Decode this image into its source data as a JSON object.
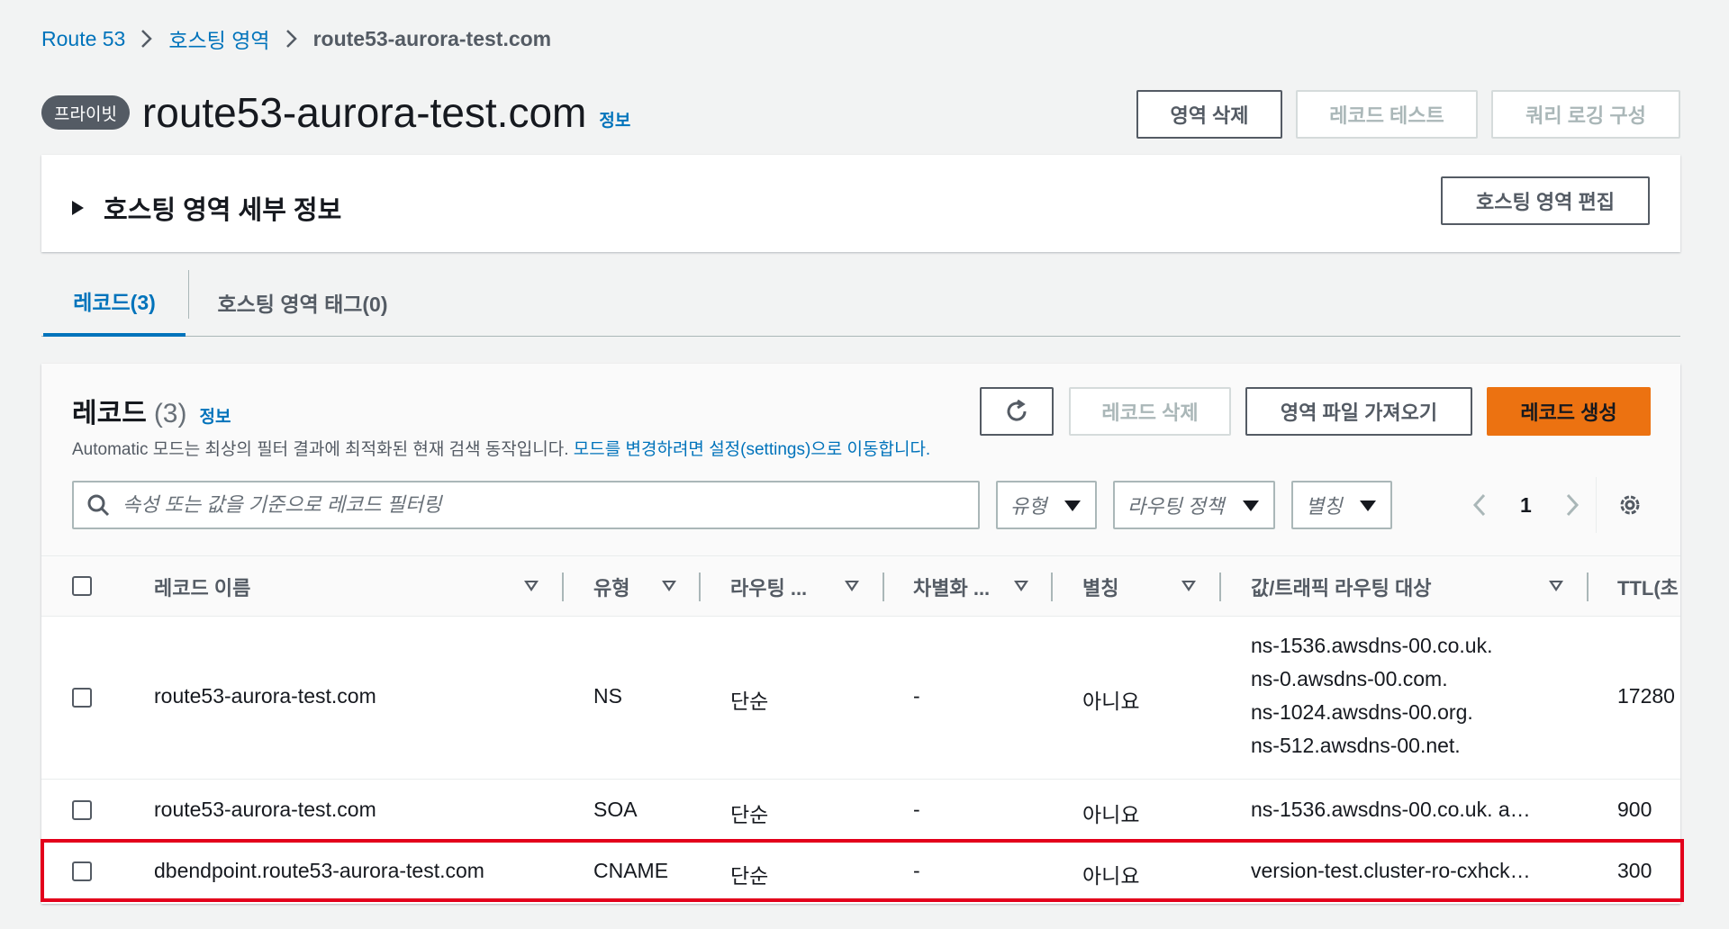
{
  "breadcrumb": {
    "items": [
      "Route 53",
      "호스팅 영역"
    ],
    "current": "route53-aurora-test.com"
  },
  "header": {
    "badge": "프라이빗",
    "title": "route53-aurora-test.com",
    "info": "정보",
    "buttons": {
      "delete_zone": "영역 삭제",
      "test_record": "레코드 테스트",
      "query_logging": "쿼리 로깅 구성"
    }
  },
  "details": {
    "title": "호스팅 영역 세부 정보",
    "edit_button": "호스팅 영역 편집"
  },
  "tabs": [
    {
      "label": "레코드(3)",
      "active": true
    },
    {
      "label": "호스팅 영역 태그(0)",
      "active": false
    }
  ],
  "records": {
    "title": "레코드",
    "count": "(3)",
    "info": "정보",
    "description": "Automatic 모드는 최상의 필터 결과에 최적화된 현재 검색 동작입니다. ",
    "description_link": "모드를 변경하려면 설정(settings)으로 이동합니다.",
    "buttons": {
      "delete": "레코드 삭제",
      "import": "영역 파일 가져오기",
      "create": "레코드 생성"
    },
    "search_placeholder": "속성 또는 값을 기준으로 레코드 필터링",
    "filters": {
      "type": "유형",
      "routing": "라우팅 정책",
      "alias": "별칭"
    },
    "page": "1",
    "columns": [
      "레코드 이름",
      "유형",
      "라우팅 ...",
      "차별화 ...",
      "별칭",
      "값/트래픽 라우팅 대상",
      "TTL(초"
    ],
    "rows": [
      {
        "name": "route53-aurora-test.com",
        "type": "NS",
        "routing": "단순",
        "diff": "-",
        "alias": "아니요",
        "values": [
          "ns-1536.awsdns-00.co.uk.",
          "ns-0.awsdns-00.com.",
          "ns-1024.awsdns-00.org.",
          "ns-512.awsdns-00.net."
        ],
        "ttl": "17280"
      },
      {
        "name": "route53-aurora-test.com",
        "type": "SOA",
        "routing": "단순",
        "diff": "-",
        "alias": "아니요",
        "values": [
          "ns-1536.awsdns-00.co.uk. a…"
        ],
        "ttl": "900"
      },
      {
        "name": "dbendpoint.route53-aurora-test.com",
        "type": "CNAME",
        "routing": "단순",
        "diff": "-",
        "alias": "아니요",
        "values": [
          "version-test.cluster-ro-cxhck…"
        ],
        "ttl": "300"
      }
    ]
  },
  "colors": {
    "link": "#0073bb",
    "primary": "#ec7211",
    "highlight": "#e3001b"
  }
}
